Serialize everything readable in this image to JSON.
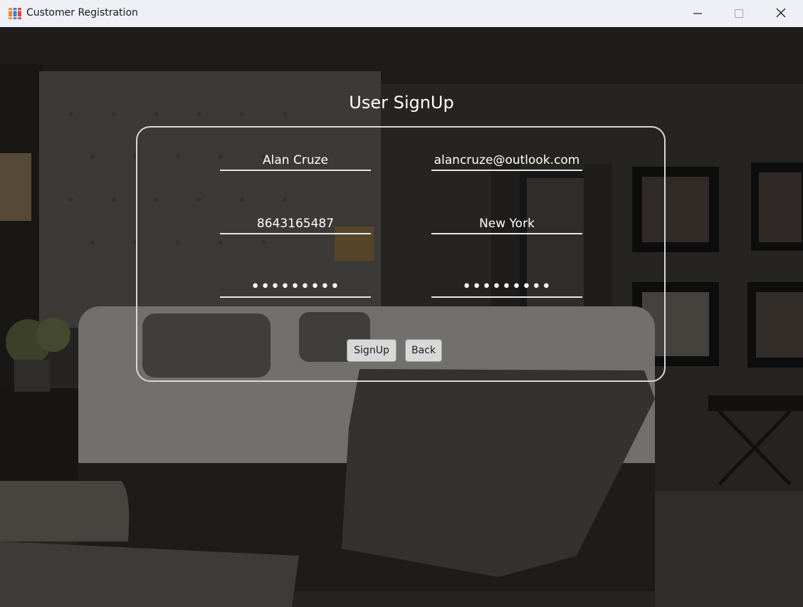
{
  "window": {
    "title": "Customer Registration",
    "icon": "app-books-icon",
    "controls": [
      "minimize-icon",
      "maximize-icon",
      "close-icon"
    ]
  },
  "form": {
    "title": "User SignUp",
    "fields": {
      "name": "Alan Cruze",
      "email": "alancruze@outlook.com",
      "phone": "8643165487",
      "city": "New York",
      "password": "•••••••••",
      "confirm_password": "•••••••••"
    },
    "buttons": {
      "signup": "SignUp",
      "back": "Back"
    }
  },
  "colors": {
    "titlebar": "#eef0f6",
    "panel_border": "#d8d8d8",
    "text": "#ffffff",
    "button_bg": "#d8d8d8"
  }
}
